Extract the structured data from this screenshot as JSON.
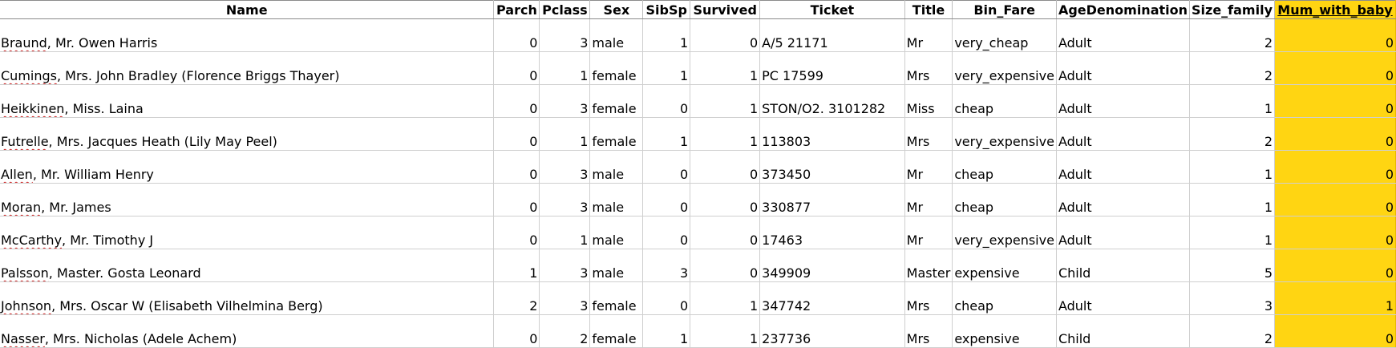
{
  "sheet": {
    "columns": [
      "Name",
      "Parch",
      "Pclass",
      "Sex",
      "SibSp",
      "Survived",
      "Ticket",
      "Title",
      "Bin_Fare",
      "AgeDenomination",
      "Size_family",
      "Mum_with_baby"
    ],
    "header_labels": {
      "name": "Name",
      "parch": "Parch",
      "pclass": "Pclass",
      "sex": "Sex",
      "sibsp": "SibSp",
      "survived": "Survived",
      "ticket": "Ticket",
      "title": "Title",
      "bin_fare": "Bin_Fare",
      "age_denom": "AgeDenomination",
      "size_family": "Size_family",
      "mum_with_baby": "Mum_with_baby"
    },
    "highlight_color": "#ffd512",
    "spellcheck_color": "#cc2222",
    "rows": [
      {
        "name_first": "Braund",
        "name_rest": ", Mr. Owen Harris",
        "parch": "0",
        "pclass": "3",
        "sex": "male",
        "sibsp": "1",
        "survived": "0",
        "ticket": "A/5 21171",
        "title": "Mr",
        "bin_fare": "very_cheap",
        "age_denom": "Adult",
        "size_family": "2",
        "mum_with_baby": "0"
      },
      {
        "name_first": "Cumings",
        "name_rest": ", Mrs. John Bradley (Florence Briggs Thayer)",
        "parch": "0",
        "pclass": "1",
        "sex": "female",
        "sibsp": "1",
        "survived": "1",
        "ticket": "PC 17599",
        "title": "Mrs",
        "bin_fare": "very_expensive",
        "age_denom": "Adult",
        "size_family": "2",
        "mum_with_baby": "0"
      },
      {
        "name_first": "Heikkinen",
        "name_rest": ", Miss. Laina",
        "parch": "0",
        "pclass": "3",
        "sex": "female",
        "sibsp": "0",
        "survived": "1",
        "ticket": "STON/O2. 3101282",
        "title": "Miss",
        "bin_fare": "cheap",
        "age_denom": "Adult",
        "size_family": "1",
        "mum_with_baby": "0"
      },
      {
        "name_first": "Futrelle",
        "name_rest": ", Mrs. Jacques Heath (Lily May Peel)",
        "parch": "0",
        "pclass": "1",
        "sex": "female",
        "sibsp": "1",
        "survived": "1",
        "ticket": "113803",
        "title": "Mrs",
        "bin_fare": "very_expensive",
        "age_denom": "Adult",
        "size_family": "2",
        "mum_with_baby": "0"
      },
      {
        "name_first": "Allen",
        "name_rest": ", Mr. William Henry",
        "parch": "0",
        "pclass": "3",
        "sex": "male",
        "sibsp": "0",
        "survived": "0",
        "ticket": "373450",
        "title": "Mr",
        "bin_fare": "cheap",
        "age_denom": "Adult",
        "size_family": "1",
        "mum_with_baby": "0"
      },
      {
        "name_first": "Moran",
        "name_rest": ", Mr. James",
        "parch": "0",
        "pclass": "3",
        "sex": "male",
        "sibsp": "0",
        "survived": "0",
        "ticket": "330877",
        "title": "Mr",
        "bin_fare": "cheap",
        "age_denom": "Adult",
        "size_family": "1",
        "mum_with_baby": "0"
      },
      {
        "name_first": "McCarthy",
        "name_rest": ", Mr. Timothy J",
        "parch": "0",
        "pclass": "1",
        "sex": "male",
        "sibsp": "0",
        "survived": "0",
        "ticket": "17463",
        "title": "Mr",
        "bin_fare": "very_expensive",
        "age_denom": "Adult",
        "size_family": "1",
        "mum_with_baby": "0"
      },
      {
        "name_first": "Palsson",
        "name_rest": ", Master. Gosta Leonard",
        "parch": "1",
        "pclass": "3",
        "sex": "male",
        "sibsp": "3",
        "survived": "0",
        "ticket": "349909",
        "title": "Master",
        "bin_fare": "expensive",
        "age_denom": "Child",
        "size_family": "5",
        "mum_with_baby": "0"
      },
      {
        "name_first": "Johnson",
        "name_rest": ", Mrs. Oscar W (Elisabeth Vilhelmina Berg)",
        "parch": "2",
        "pclass": "3",
        "sex": "female",
        "sibsp": "0",
        "survived": "1",
        "ticket": "347742",
        "title": "Mrs",
        "bin_fare": "cheap",
        "age_denom": "Adult",
        "size_family": "3",
        "mum_with_baby": "1"
      },
      {
        "name_first": "Nasser",
        "name_rest": ", Mrs. Nicholas (Adele Achem)",
        "parch": "0",
        "pclass": "2",
        "sex": "female",
        "sibsp": "1",
        "survived": "1",
        "ticket": "237736",
        "title": "Mrs",
        "bin_fare": "expensive",
        "age_denom": "Child",
        "size_family": "2",
        "mum_with_baby": "0"
      }
    ]
  }
}
